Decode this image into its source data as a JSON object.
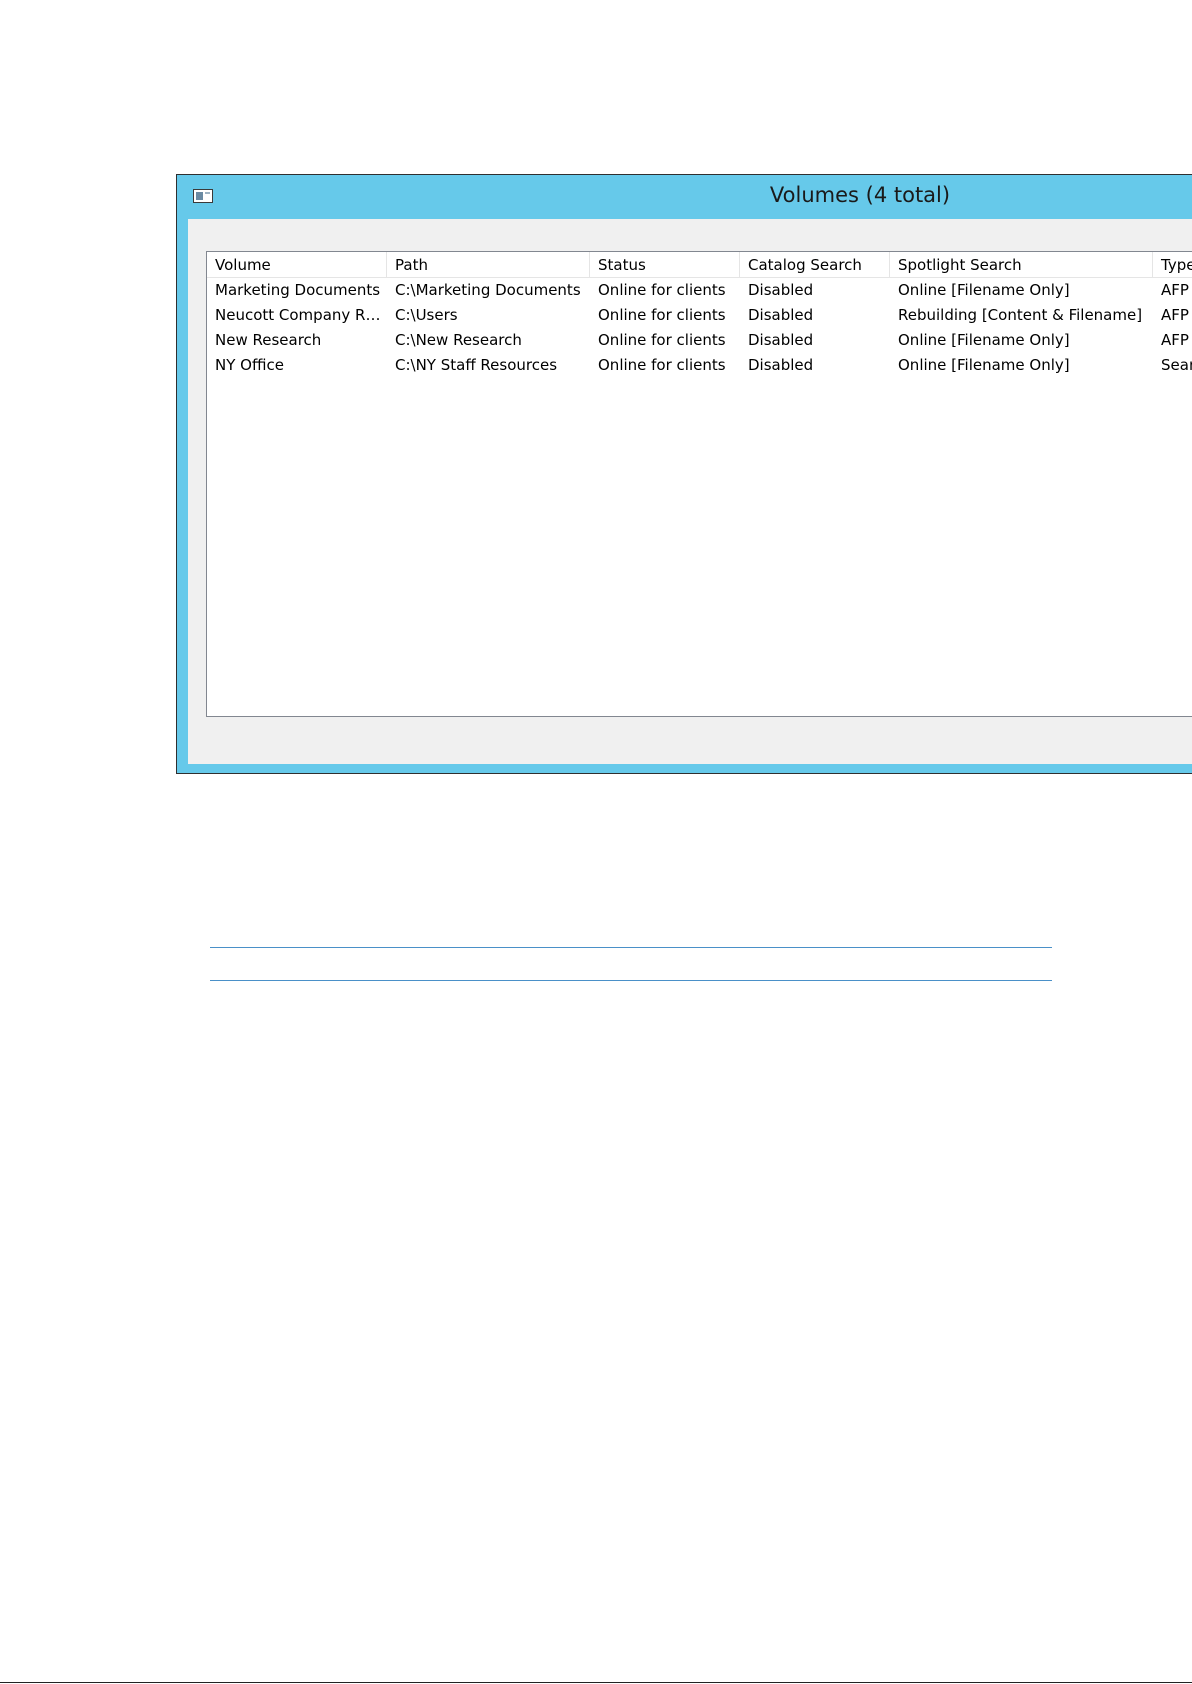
{
  "window": {
    "title": "Volumes (4 total)",
    "icon": "window-icon"
  },
  "table": {
    "columns": [
      "Volume",
      "Path",
      "Status",
      "Catalog Search",
      "Spotlight Search",
      "Type"
    ],
    "rows": [
      [
        "Marketing Documents",
        "C:\\Marketing Documents",
        "Online for clients",
        "Disabled",
        "Online [Filename Only]",
        "AFP"
      ],
      [
        "Neucott Company R…",
        "C:\\Users",
        "Online for clients",
        "Disabled",
        "Rebuilding [Content & Filename]",
        "AFP"
      ],
      [
        "New Research",
        "C:\\New Research",
        "Online for clients",
        "Disabled",
        "Online [Filename Only]",
        "AFP"
      ],
      [
        "NY Office",
        "C:\\NY Staff Resources",
        "Online for clients",
        "Disabled",
        "Online [Filename Only]",
        "Search"
      ]
    ]
  },
  "colors": {
    "titlebar": "#66c9ea",
    "client": "#f0f0f0",
    "rule": "#4a90c8"
  }
}
